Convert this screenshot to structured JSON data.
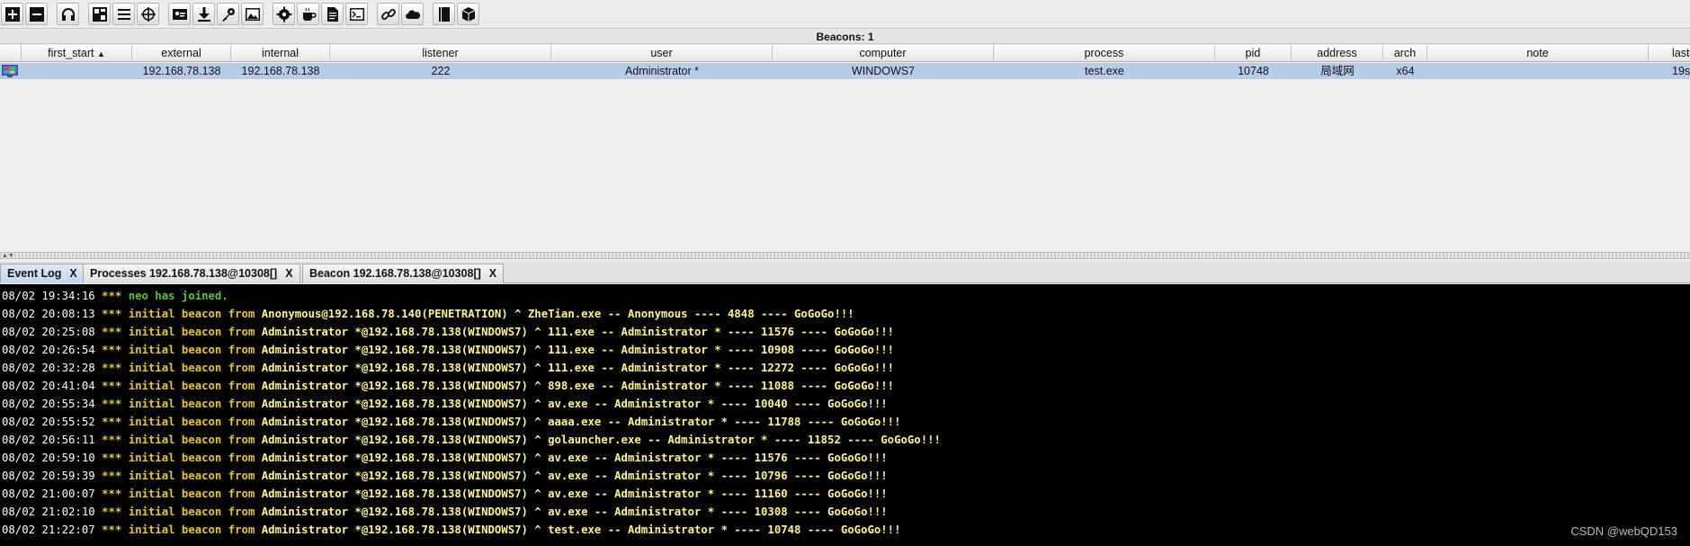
{
  "toolbar": {
    "buttons": [
      "add-icon",
      "remove-icon",
      "headphones-icon",
      "pivot-graph-icon",
      "session-list-icon",
      "target-crosshair-icon",
      "credentials-icon",
      "download-icon",
      "key-icon",
      "image-icon",
      "gear-icon",
      "coffee-cup-icon",
      "document-icon",
      "terminal-icon",
      "link-icon",
      "cloud-icon",
      "book-icon",
      "package-icon"
    ]
  },
  "beacons": {
    "title": "Beacons: 1",
    "columns": [
      "first_start",
      "external",
      "internal",
      "listener",
      "user",
      "computer",
      "process",
      "pid",
      "address",
      "arch",
      "note",
      "last"
    ],
    "sort_indicator": "▲",
    "rows": [
      {
        "first_start": "",
        "external": "192.168.78.138",
        "internal": "192.168.78.138",
        "listener": "222",
        "user": "Administrator *",
        "computer": "WINDOWS7",
        "process": "test.exe",
        "pid": "10748",
        "address": "局域网",
        "arch": "x64",
        "note": "",
        "last": "19s"
      }
    ]
  },
  "tabs": [
    {
      "label": "Event Log",
      "close": "X",
      "active": true
    },
    {
      "label": "Processes 192.168.78.138@10308[]",
      "close": "X",
      "active": false
    },
    {
      "label": "Beacon 192.168.78.138@10308[]",
      "close": "X",
      "active": false
    }
  ],
  "event_log": [
    {
      "ts": "08/02 19:34:16",
      "stars": "***",
      "kind": "join",
      "text": "neo has joined.",
      "who": ""
    },
    {
      "ts": "08/02 20:08:13",
      "stars": "***",
      "kind": "init",
      "text": "initial beacon from",
      "who": "Anonymous@192.168.78.140(PENETRATION) ^ ZheTian.exe -- Anonymous ---- 4848 ---- GoGoGo!!!"
    },
    {
      "ts": "08/02 20:25:08",
      "stars": "***",
      "kind": "init",
      "text": "initial beacon from",
      "who": "Administrator *@192.168.78.138(WINDOWS7) ^ 111.exe -- Administrator * ---- 11576 ---- GoGoGo!!!"
    },
    {
      "ts": "08/02 20:26:54",
      "stars": "***",
      "kind": "init",
      "text": "initial beacon from",
      "who": "Administrator *@192.168.78.138(WINDOWS7) ^ 111.exe -- Administrator * ---- 10908 ---- GoGoGo!!!"
    },
    {
      "ts": "08/02 20:32:28",
      "stars": "***",
      "kind": "init",
      "text": "initial beacon from",
      "who": "Administrator *@192.168.78.138(WINDOWS7) ^ 111.exe -- Administrator * ---- 12272 ---- GoGoGo!!!"
    },
    {
      "ts": "08/02 20:41:04",
      "stars": "***",
      "kind": "init",
      "text": "initial beacon from",
      "who": "Administrator *@192.168.78.138(WINDOWS7) ^ 898.exe -- Administrator * ---- 11088 ---- GoGoGo!!!"
    },
    {
      "ts": "08/02 20:55:34",
      "stars": "***",
      "kind": "init",
      "text": "initial beacon from",
      "who": "Administrator *@192.168.78.138(WINDOWS7) ^ av.exe -- Administrator * ---- 10040 ---- GoGoGo!!!"
    },
    {
      "ts": "08/02 20:55:52",
      "stars": "***",
      "kind": "init",
      "text": "initial beacon from",
      "who": "Administrator *@192.168.78.138(WINDOWS7) ^ aaaa.exe -- Administrator * ---- 11788 ---- GoGoGo!!!"
    },
    {
      "ts": "08/02 20:56:11",
      "stars": "***",
      "kind": "init",
      "text": "initial beacon from",
      "who": "Administrator *@192.168.78.138(WINDOWS7) ^ golauncher.exe -- Administrator * ---- 11852 ---- GoGoGo!!!"
    },
    {
      "ts": "08/02 20:59:10",
      "stars": "***",
      "kind": "init",
      "text": "initial beacon from",
      "who": "Administrator *@192.168.78.138(WINDOWS7) ^ av.exe -- Administrator * ---- 11576 ---- GoGoGo!!!"
    },
    {
      "ts": "08/02 20:59:39",
      "stars": "***",
      "kind": "init",
      "text": "initial beacon from",
      "who": "Administrator *@192.168.78.138(WINDOWS7) ^ av.exe -- Administrator * ---- 10796 ---- GoGoGo!!!"
    },
    {
      "ts": "08/02 21:00:07",
      "stars": "***",
      "kind": "init",
      "text": "initial beacon from",
      "who": "Administrator *@192.168.78.138(WINDOWS7) ^ av.exe -- Administrator * ---- 11160 ---- GoGoGo!!!"
    },
    {
      "ts": "08/02 21:02:10",
      "stars": "***",
      "kind": "init",
      "text": "initial beacon from",
      "who": "Administrator *@192.168.78.138(WINDOWS7) ^ av.exe -- Administrator * ---- 10308 ---- GoGoGo!!!"
    },
    {
      "ts": "08/02 21:22:07",
      "stars": "***",
      "kind": "init",
      "text": "initial beacon from",
      "who": "Administrator *@192.168.78.138(WINDOWS7) ^ test.exe -- Administrator * ---- 10748 ---- GoGoGo!!!"
    }
  ],
  "watermark": "CSDN @webQD153",
  "colors": {
    "selected_row": "#b8cce6",
    "console_bg": "#000000",
    "highlight_yellow": "#e8c628",
    "join_green": "#5ec240"
  }
}
